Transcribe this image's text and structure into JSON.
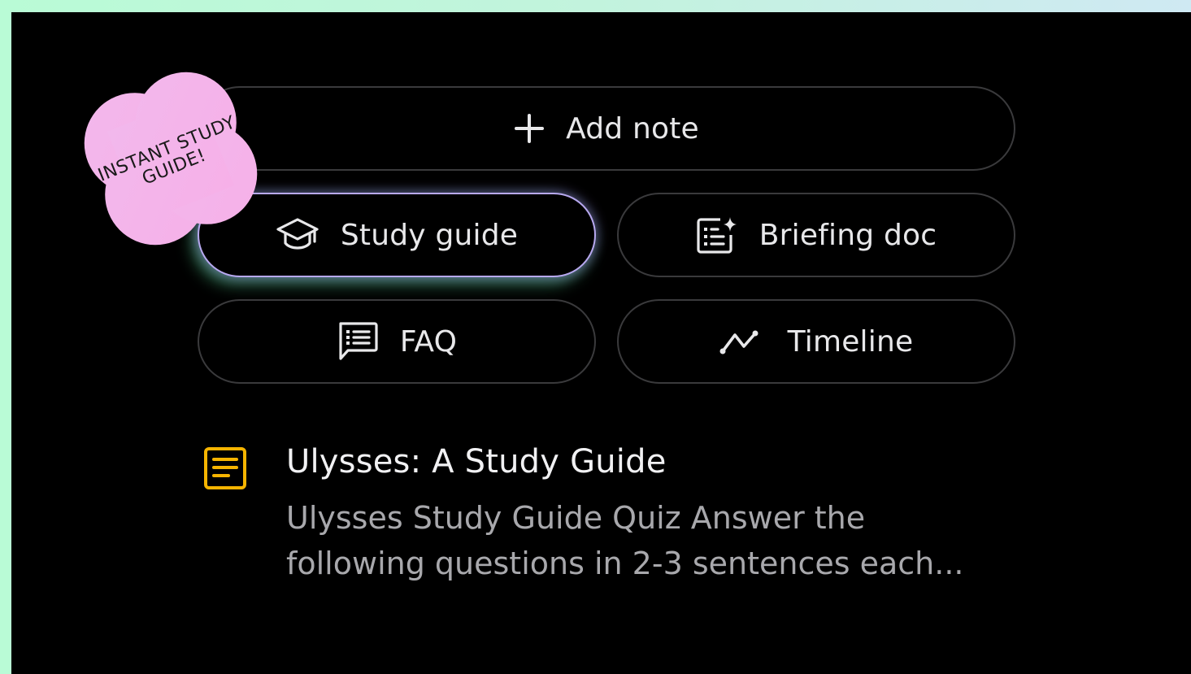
{
  "actions": {
    "add_note": {
      "label": "Add note",
      "icon": "plus-icon"
    },
    "study_guide": {
      "label": "Study guide",
      "icon": "graduation-cap-icon"
    },
    "briefing_doc": {
      "label": "Briefing doc",
      "icon": "doc-sparkle-icon"
    },
    "faq": {
      "label": "FAQ",
      "icon": "chat-list-icon"
    },
    "timeline": {
      "label": "Timeline",
      "icon": "trend-line-icon"
    }
  },
  "sticker": {
    "line1": "INSTANT STUDY",
    "line2": "GUIDE!",
    "color": "#f5b6ea"
  },
  "note": {
    "icon": "note-doc-icon",
    "icon_color": "#f6b400",
    "title": "Ulysses: A Study Guide",
    "snippet": "Ulysses Study Guide Quiz Answer the following questions in 2-3 sentences each..."
  },
  "colors": {
    "background_gradient_left": "#b9fbd6",
    "background_gradient_right": "#cfe9f3",
    "panel": "#000000",
    "highlight_border": "#b8a9f0"
  }
}
